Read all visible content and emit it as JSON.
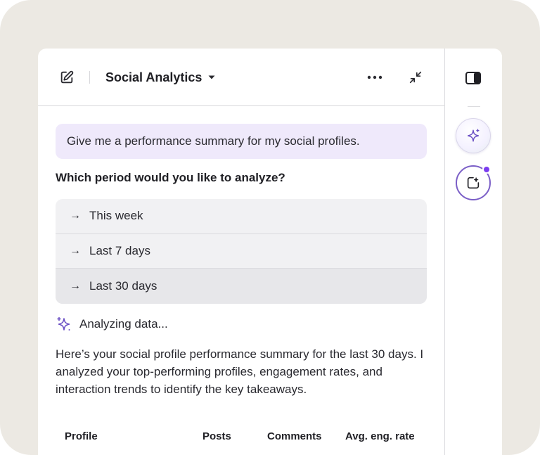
{
  "header": {
    "title": "Social Analytics",
    "icons": {
      "edit": "edit-square-icon",
      "dropdown": "caret-down-icon",
      "more": "more-horizontal-icon",
      "collapse": "collapse-arrows-icon"
    }
  },
  "chat": {
    "prompt": "Give me a performance summary for my social profiles.",
    "question": "Which period would you like to analyze?",
    "options": [
      {
        "label": "This week"
      },
      {
        "label": "Last 7 days"
      },
      {
        "label": "Last 30 days"
      }
    ],
    "status": "Analyzing data...",
    "summary": "Here’s your social profile performance summary for the last 30 days. I analyzed your top-performing profiles, engagement rates, and interaction trends to identify the key takeaways."
  },
  "table": {
    "columns": [
      "Profile",
      "Posts",
      "Comments",
      "Avg. eng. rate"
    ]
  },
  "side_panel": {
    "icons": {
      "toggle": "panel-right-icon",
      "assistant": "sparkle-icon",
      "new_chat": "new-chat-sparkle-icon"
    }
  },
  "colors": {
    "frame_bg": "#ece9e3",
    "prompt_bg": "#efe9fb",
    "accent_purple": "#7b3cf0",
    "sparkle_purple": "#7b5fc7"
  }
}
